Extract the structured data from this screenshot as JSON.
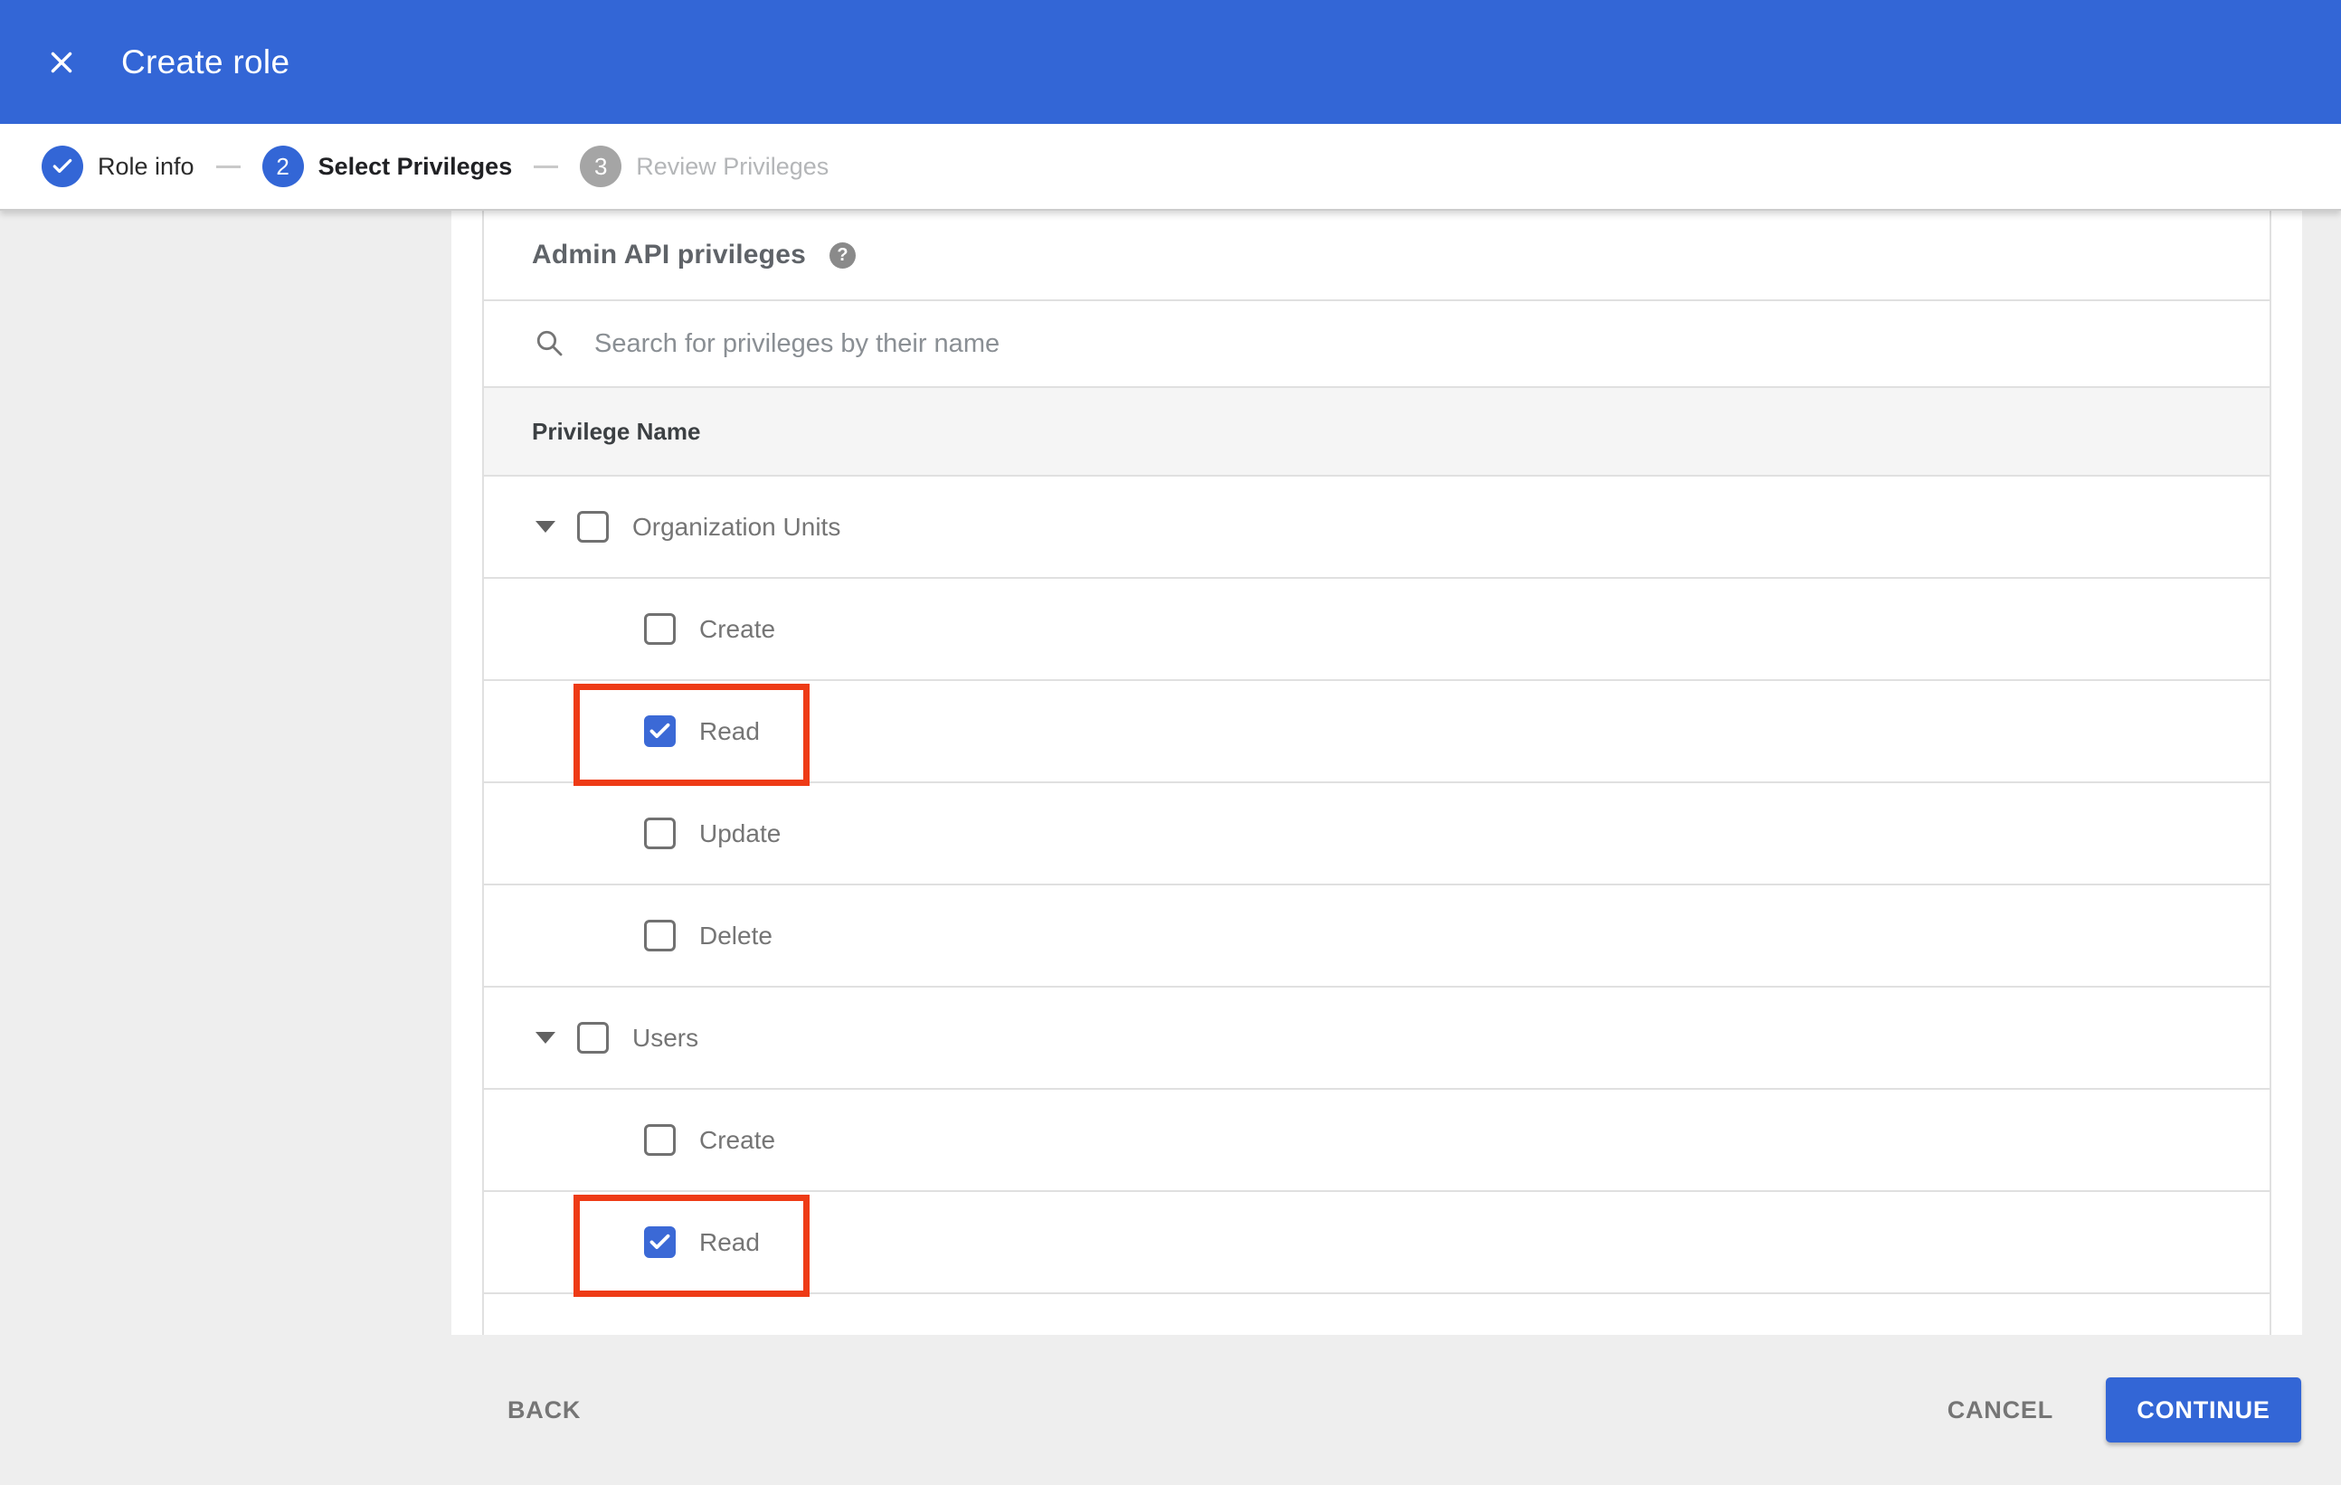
{
  "header": {
    "title": "Create role"
  },
  "stepper": {
    "steps": [
      {
        "label": "Role info",
        "state": "complete",
        "number": ""
      },
      {
        "label": "Select Privileges",
        "state": "current",
        "number": "2"
      },
      {
        "label": "Review Privileges",
        "state": "future",
        "number": "3"
      }
    ]
  },
  "panel": {
    "title": "Admin API privileges",
    "search": {
      "placeholder": "Search for privileges by their name"
    },
    "table_header": "Privilege Name",
    "rows": [
      {
        "label": "Organization Units",
        "type": "parent",
        "checked": false,
        "highlighted": false
      },
      {
        "label": "Create",
        "type": "child",
        "checked": false,
        "highlighted": false
      },
      {
        "label": "Read",
        "type": "child",
        "checked": true,
        "highlighted": true
      },
      {
        "label": "Update",
        "type": "child",
        "checked": false,
        "highlighted": false
      },
      {
        "label": "Delete",
        "type": "child",
        "checked": false,
        "highlighted": false
      },
      {
        "label": "Users",
        "type": "parent",
        "checked": false,
        "highlighted": false
      },
      {
        "label": "Create",
        "type": "child",
        "checked": false,
        "highlighted": false
      },
      {
        "label": "Read",
        "type": "child",
        "checked": true,
        "highlighted": true
      }
    ]
  },
  "footer": {
    "back_label": "BACK",
    "cancel_label": "CANCEL",
    "continue_label": "CONTINUE"
  },
  "icons": {
    "help_glyph": "?"
  },
  "colors": {
    "accent_blue": "#3366d6",
    "checkbox_blue": "#3b69d6",
    "highlight_red": "#ee3b16",
    "page_background": "#eeeeee",
    "row_border": "#e0e0e0",
    "table_header_background": "#f5f5f5"
  }
}
